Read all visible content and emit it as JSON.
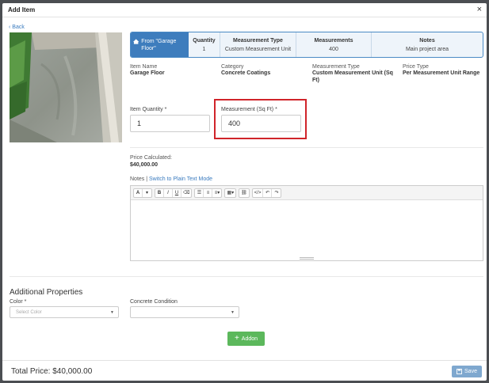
{
  "modal": {
    "title": "Add Item",
    "close_glyph": "×",
    "back_label": "Back"
  },
  "info_bar": {
    "from_label": "From \"Garage Floor\"",
    "columns": [
      {
        "header": "Quantity",
        "value": "1"
      },
      {
        "header": "Measurement Type",
        "value": "Custom Measurement Unit"
      },
      {
        "header": "Measurements",
        "value": "400"
      },
      {
        "header": "Notes",
        "value": "Main project area"
      }
    ]
  },
  "details": {
    "item_name_label": "Item Name",
    "item_name": "Garage Floor",
    "category_label": "Category",
    "category": "Concrete Coatings",
    "measurement_type_label": "Measurement Type",
    "measurement_type": "Custom Measurement Unit (Sq Ft)",
    "price_type_label": "Price Type",
    "price_type": "Per Measurement Unit Range"
  },
  "form": {
    "quantity_label": "Item Quantity *",
    "quantity_value": "1",
    "measurement_label": "Measurement (Sq Ft) *",
    "measurement_value": "400"
  },
  "price": {
    "label": "Price Calculated:",
    "value": "$40,000.00"
  },
  "notes": {
    "label": "Notes |",
    "switch_link": "Switch to Plain Text Mode"
  },
  "toolbar": {
    "font_glyph": "A",
    "dropdown_glyph": "▾",
    "bold": "B",
    "italic": "I",
    "underline": "U",
    "eraser": "⌫",
    "bullet_list": "☰",
    "numbered_list": "≡",
    "align": "≡",
    "table": "▦",
    "link": "⛓",
    "code": "</>",
    "undo": "↶",
    "redo": "↷"
  },
  "additional": {
    "title": "Additional Properties",
    "color_label": "Color *",
    "color_placeholder": "Select Color",
    "condition_label": "Concrete Condition",
    "condition_value": ""
  },
  "addon_button": {
    "plus": "+",
    "label": "Addon"
  },
  "footer": {
    "total_label": "Total Price: $40,000.00",
    "save_label": "Save"
  },
  "colors": {
    "accent_blue": "#3e7dbd",
    "highlight_red": "#d0242a",
    "addon_green": "#5cb85c",
    "save_blue": "#7fa8cf"
  },
  "icons": {
    "house": "house-icon",
    "close": "close-icon",
    "save": "floppy-disk-icon",
    "plus": "plus-icon"
  }
}
